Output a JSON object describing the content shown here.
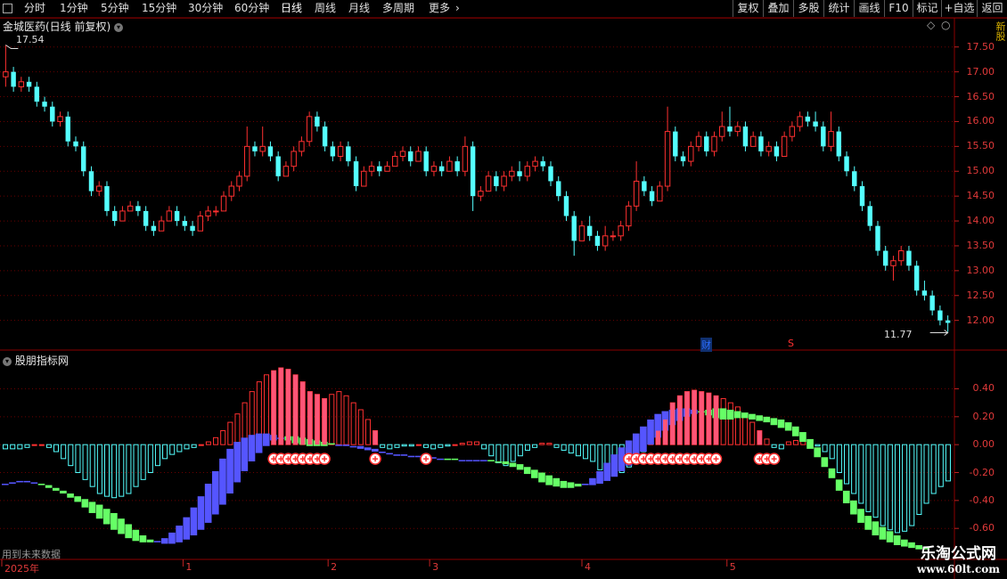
{
  "toolbar": {
    "periods": [
      "分时",
      "1分钟",
      "5分钟",
      "15分钟",
      "30分钟",
      "60分钟",
      "日线",
      "周线",
      "月线",
      "多周期",
      "更多"
    ],
    "active_period": "日线",
    "more_arrow": "›",
    "right_buttons": [
      "复权",
      "叠加",
      "多股",
      "统计",
      "画线",
      "F10",
      "标记",
      "+自选",
      "返回"
    ]
  },
  "price_panel": {
    "title": "金城医药(日线 前复权)",
    "high_label": "17.54",
    "low_label": "11.77",
    "cai_mark": "财",
    "s_mark": "S",
    "right_strip_text": "新股",
    "chart_data": {
      "type": "candlestick",
      "ylim": [
        11.6,
        17.8
      ],
      "yticks": [
        "17.50",
        "17.00",
        "16.50",
        "16.00",
        "15.50",
        "15.00",
        "14.50",
        "14.00",
        "13.50",
        "13.00",
        "12.50",
        "12.00"
      ],
      "up_color": "#ff3030",
      "down_color": "#54ffff",
      "candles": [
        [
          16.9,
          17.0,
          16.7,
          17.54
        ],
        [
          17.0,
          16.7,
          16.6,
          17.1
        ],
        [
          16.7,
          16.8,
          16.6,
          16.9
        ],
        [
          16.8,
          16.7,
          16.6,
          16.9
        ],
        [
          16.7,
          16.4,
          16.3,
          16.8
        ],
        [
          16.4,
          16.3,
          16.2,
          16.5
        ],
        [
          16.3,
          16.0,
          15.9,
          16.4
        ],
        [
          16.0,
          16.1,
          15.9,
          16.2
        ],
        [
          16.1,
          15.6,
          15.5,
          16.2
        ],
        [
          15.6,
          15.5,
          15.4,
          15.7
        ],
        [
          15.5,
          15.0,
          14.9,
          15.6
        ],
        [
          15.0,
          14.6,
          14.5,
          15.1
        ],
        [
          14.6,
          14.7,
          14.5,
          14.8
        ],
        [
          14.7,
          14.2,
          14.1,
          14.8
        ],
        [
          14.2,
          14.0,
          13.9,
          14.3
        ],
        [
          14.0,
          14.2,
          14.0,
          14.3
        ],
        [
          14.2,
          14.3,
          14.2,
          14.4
        ],
        [
          14.3,
          14.2,
          14.1,
          14.4
        ],
        [
          14.2,
          13.9,
          13.8,
          14.3
        ],
        [
          13.9,
          13.8,
          13.7,
          14.0
        ],
        [
          13.8,
          14.0,
          13.8,
          14.1
        ],
        [
          14.0,
          14.2,
          14.0,
          14.3
        ],
        [
          14.2,
          14.0,
          13.9,
          14.3
        ],
        [
          14.0,
          13.9,
          13.8,
          14.1
        ],
        [
          13.9,
          13.8,
          13.7,
          14.0
        ],
        [
          13.8,
          14.1,
          13.8,
          14.2
        ],
        [
          14.1,
          14.2,
          14.0,
          14.3
        ],
        [
          14.2,
          14.2,
          14.1,
          14.3
        ],
        [
          14.2,
          14.5,
          14.2,
          14.6
        ],
        [
          14.5,
          14.7,
          14.4,
          14.8
        ],
        [
          14.7,
          14.9,
          14.6,
          15.0
        ],
        [
          14.9,
          15.5,
          14.8,
          15.9
        ],
        [
          15.5,
          15.4,
          15.3,
          15.6
        ],
        [
          15.4,
          15.5,
          15.3,
          15.9
        ],
        [
          15.5,
          15.3,
          15.2,
          15.6
        ],
        [
          15.3,
          14.9,
          14.8,
          15.4
        ],
        [
          14.9,
          15.1,
          14.9,
          15.2
        ],
        [
          15.1,
          15.4,
          15.0,
          15.5
        ],
        [
          15.4,
          15.6,
          15.3,
          15.7
        ],
        [
          15.6,
          16.1,
          15.5,
          16.2
        ],
        [
          16.1,
          15.9,
          15.8,
          16.2
        ],
        [
          15.9,
          15.5,
          15.4,
          16.0
        ],
        [
          15.5,
          15.3,
          15.2,
          15.6
        ],
        [
          15.3,
          15.5,
          15.2,
          15.6
        ],
        [
          15.5,
          15.2,
          15.1,
          15.6
        ],
        [
          15.2,
          14.7,
          14.6,
          15.3
        ],
        [
          14.7,
          15.0,
          14.7,
          15.1
        ],
        [
          15.0,
          15.1,
          14.9,
          15.2
        ],
        [
          15.1,
          15.0,
          14.9,
          15.2
        ],
        [
          15.0,
          15.1,
          15.0,
          15.2
        ],
        [
          15.1,
          15.3,
          15.1,
          15.4
        ],
        [
          15.3,
          15.4,
          15.2,
          15.5
        ],
        [
          15.4,
          15.2,
          15.1,
          15.5
        ],
        [
          15.2,
          15.4,
          15.2,
          15.5
        ],
        [
          15.4,
          15.0,
          14.9,
          15.5
        ],
        [
          15.0,
          15.1,
          14.9,
          15.2
        ],
        [
          15.1,
          15.0,
          14.9,
          15.2
        ],
        [
          15.0,
          15.2,
          15.0,
          15.3
        ],
        [
          15.2,
          15.0,
          14.9,
          15.3
        ],
        [
          15.0,
          15.5,
          14.9,
          15.7
        ],
        [
          15.5,
          14.5,
          14.2,
          15.6
        ],
        [
          14.5,
          14.6,
          14.4,
          14.7
        ],
        [
          14.6,
          14.9,
          14.6,
          15.0
        ],
        [
          14.9,
          14.7,
          14.6,
          15.0
        ],
        [
          14.7,
          14.9,
          14.6,
          15.0
        ],
        [
          14.9,
          15.0,
          14.8,
          15.1
        ],
        [
          15.0,
          14.9,
          14.8,
          15.2
        ],
        [
          14.9,
          15.1,
          14.8,
          15.2
        ],
        [
          15.1,
          15.2,
          15.0,
          15.3
        ],
        [
          15.2,
          15.1,
          15.0,
          15.3
        ],
        [
          15.1,
          14.8,
          14.7,
          15.2
        ],
        [
          14.8,
          14.5,
          14.4,
          14.9
        ],
        [
          14.5,
          14.1,
          14.0,
          14.6
        ],
        [
          14.1,
          13.6,
          13.3,
          14.2
        ],
        [
          13.6,
          13.9,
          13.6,
          14.0
        ],
        [
          13.9,
          13.7,
          13.6,
          14.1
        ],
        [
          13.7,
          13.5,
          13.4,
          13.8
        ],
        [
          13.5,
          13.7,
          13.4,
          13.9
        ],
        [
          13.7,
          13.7,
          13.6,
          13.8
        ],
        [
          13.7,
          13.9,
          13.6,
          14.0
        ],
        [
          13.9,
          14.3,
          13.8,
          14.4
        ],
        [
          14.3,
          14.8,
          14.2,
          15.2
        ],
        [
          14.8,
          14.6,
          14.5,
          14.9
        ],
        [
          14.6,
          14.4,
          14.3,
          14.7
        ],
        [
          14.4,
          14.7,
          14.4,
          14.8
        ],
        [
          14.7,
          15.8,
          14.6,
          16.3
        ],
        [
          15.8,
          15.3,
          15.2,
          15.9
        ],
        [
          15.3,
          15.2,
          15.1,
          15.4
        ],
        [
          15.2,
          15.5,
          15.1,
          15.6
        ],
        [
          15.5,
          15.7,
          15.4,
          15.8
        ],
        [
          15.7,
          15.4,
          15.3,
          15.8
        ],
        [
          15.4,
          15.7,
          15.3,
          15.8
        ],
        [
          15.7,
          15.9,
          15.6,
          16.2
        ],
        [
          15.9,
          15.8,
          15.7,
          16.3
        ],
        [
          15.8,
          15.9,
          15.7,
          16.0
        ],
        [
          15.9,
          15.5,
          15.4,
          16.0
        ],
        [
          15.5,
          15.7,
          15.5,
          15.8
        ],
        [
          15.7,
          15.4,
          15.3,
          15.8
        ],
        [
          15.4,
          15.5,
          15.3,
          15.6
        ],
        [
          15.5,
          15.3,
          15.2,
          15.6
        ],
        [
          15.3,
          15.7,
          15.3,
          15.8
        ],
        [
          15.7,
          15.9,
          15.6,
          16.0
        ],
        [
          15.9,
          16.1,
          15.8,
          16.2
        ],
        [
          16.1,
          16.0,
          15.9,
          16.2
        ],
        [
          16.0,
          15.9,
          15.8,
          16.2
        ],
        [
          15.9,
          15.5,
          15.4,
          16.0
        ],
        [
          15.5,
          15.8,
          15.4,
          16.2
        ],
        [
          15.8,
          15.3,
          15.2,
          15.9
        ],
        [
          15.3,
          15.0,
          14.9,
          15.4
        ],
        [
          15.0,
          14.7,
          14.6,
          15.1
        ],
        [
          14.7,
          14.3,
          14.2,
          14.8
        ],
        [
          14.3,
          13.9,
          13.8,
          14.4
        ],
        [
          13.9,
          13.4,
          13.3,
          14.0
        ],
        [
          13.4,
          13.1,
          13.0,
          13.5
        ],
        [
          13.1,
          13.2,
          12.8,
          13.3
        ],
        [
          13.2,
          13.4,
          13.1,
          13.5
        ],
        [
          13.4,
          13.1,
          13.0,
          13.5
        ],
        [
          13.1,
          12.6,
          12.5,
          13.2
        ],
        [
          12.6,
          12.5,
          12.4,
          12.8
        ],
        [
          12.5,
          12.2,
          12.1,
          12.6
        ],
        [
          12.2,
          12.0,
          11.9,
          12.3
        ],
        [
          12.0,
          11.95,
          11.77,
          12.1
        ]
      ]
    }
  },
  "indicator_panel": {
    "title": "股朋指标网",
    "footer_note": "用到未来数据",
    "chart_data": {
      "type": "bar",
      "ylim": [
        -0.72,
        0.62
      ],
      "yticks": [
        "0.40",
        "0.20",
        "0.00",
        "-0.20",
        "-0.40",
        "-0.60"
      ],
      "histogram": [
        -0.03,
        -0.03,
        -0.03,
        -0.02,
        0.0,
        0.0,
        -0.02,
        -0.05,
        -0.1,
        -0.15,
        -0.2,
        -0.25,
        -0.3,
        -0.35,
        -0.37,
        -0.38,
        -0.37,
        -0.35,
        -0.3,
        -0.25,
        -0.2,
        -0.15,
        -0.1,
        -0.07,
        -0.05,
        -0.03,
        -0.02,
        0.0,
        0.02,
        0.05,
        0.1,
        0.16,
        0.22,
        0.3,
        0.38,
        0.45,
        0.5,
        0.53,
        0.55,
        0.54,
        0.5,
        0.45,
        0.38,
        0.36,
        0.33,
        0.36,
        0.38,
        0.35,
        0.3,
        0.25,
        0.18,
        0.1,
        -0.02,
        -0.03,
        -0.02,
        -0.01,
        -0.01,
        0.0,
        -0.02,
        -0.03,
        -0.02,
        -0.01,
        0.0,
        0.01,
        0.02,
        0.02,
        -0.03,
        -0.08,
        -0.13,
        -0.15,
        -0.12,
        -0.08,
        -0.04,
        -0.02,
        0.01,
        0.01,
        -0.02,
        -0.04,
        -0.06,
        -0.08,
        -0.1,
        -0.12,
        -0.18,
        -0.22,
        -0.22,
        -0.2,
        -0.16,
        -0.1,
        -0.05,
        0.05,
        0.1,
        0.18,
        0.3,
        0.35,
        0.38,
        0.39,
        0.38,
        0.37,
        0.35,
        0.33,
        0.3,
        0.27,
        0.22,
        0.16,
        0.1,
        0.04,
        -0.02,
        -0.03,
        0.02,
        0.03,
        0.04,
        0.02,
        -0.01,
        -0.05,
        -0.1,
        -0.2,
        -0.28,
        -0.35,
        -0.42,
        -0.48,
        -0.52,
        -0.58,
        -0.61,
        -0.63,
        -0.62,
        -0.58,
        -0.5,
        -0.42,
        -0.35,
        -0.3,
        -0.26
      ],
      "line_a": [
        -0.28,
        -0.27,
        -0.26,
        -0.26,
        -0.27,
        -0.29,
        -0.31,
        -0.33,
        -0.35,
        -0.38,
        -0.41,
        -0.45,
        -0.49,
        -0.53,
        -0.57,
        -0.61,
        -0.64,
        -0.67,
        -0.69,
        -0.7,
        -0.7,
        -0.69,
        -0.67,
        -0.63,
        -0.58,
        -0.52,
        -0.45,
        -0.37,
        -0.28,
        -0.19,
        -0.1,
        -0.03,
        0.02,
        0.05,
        0.07,
        0.08,
        0.08,
        0.07,
        0.05,
        0.03,
        0.01,
        0.0,
        -0.01,
        -0.01,
        -0.01,
        0.0,
        0.0,
        0.0,
        -0.01,
        -0.01,
        -0.02,
        -0.03,
        -0.05,
        -0.06,
        -0.07,
        -0.07,
        -0.08,
        -0.08,
        -0.08,
        -0.09,
        -0.1,
        -0.11,
        -0.11,
        -0.11,
        -0.11,
        -0.11,
        -0.11,
        -0.12,
        -0.13,
        -0.14,
        -0.16,
        -0.18,
        -0.21,
        -0.24,
        -0.27,
        -0.29,
        -0.3,
        -0.31,
        -0.31,
        -0.3,
        -0.28,
        -0.24,
        -0.19,
        -0.13,
        -0.07,
        -0.02,
        0.03,
        0.08,
        0.13,
        0.18,
        0.22,
        0.24,
        0.25,
        0.26,
        0.26,
        0.25,
        0.23,
        0.21,
        0.19,
        0.18,
        0.18,
        0.19,
        0.19,
        0.18,
        0.17,
        0.16,
        0.14,
        0.12,
        0.1,
        0.06,
        0.02,
        -0.03,
        -0.09,
        -0.16,
        -0.24,
        -0.33,
        -0.42,
        -0.5,
        -0.56,
        -0.61,
        -0.65,
        -0.68,
        -0.7,
        -0.72,
        -0.73,
        -0.74,
        -0.75,
        -0.75
      ],
      "line_b": [
        -0.28,
        -0.28,
        -0.27,
        -0.27,
        -0.27,
        -0.28,
        -0.29,
        -0.31,
        -0.33,
        -0.35,
        -0.37,
        -0.39,
        -0.41,
        -0.43,
        -0.46,
        -0.49,
        -0.53,
        -0.57,
        -0.61,
        -0.65,
        -0.68,
        -0.7,
        -0.71,
        -0.71,
        -0.7,
        -0.68,
        -0.65,
        -0.61,
        -0.56,
        -0.5,
        -0.43,
        -0.35,
        -0.27,
        -0.19,
        -0.12,
        -0.06,
        -0.01,
        0.03,
        0.05,
        0.06,
        0.06,
        0.05,
        0.04,
        0.03,
        0.02,
        0.01,
        0.0,
        -0.01,
        -0.02,
        -0.03,
        -0.04,
        -0.05,
        -0.06,
        -0.07,
        -0.08,
        -0.08,
        -0.09,
        -0.09,
        -0.1,
        -0.1,
        -0.1,
        -0.1,
        -0.1,
        -0.11,
        -0.11,
        -0.11,
        -0.11,
        -0.11,
        -0.12,
        -0.12,
        -0.13,
        -0.14,
        -0.16,
        -0.18,
        -0.2,
        -0.22,
        -0.24,
        -0.26,
        -0.27,
        -0.28,
        -0.29,
        -0.29,
        -0.28,
        -0.26,
        -0.23,
        -0.19,
        -0.15,
        -0.1,
        -0.05,
        0.0,
        0.05,
        0.1,
        0.14,
        0.17,
        0.2,
        0.22,
        0.24,
        0.25,
        0.26,
        0.26,
        0.25,
        0.24,
        0.23,
        0.22,
        0.21,
        0.2,
        0.19,
        0.18,
        0.16,
        0.13,
        0.09,
        0.04,
        -0.02,
        -0.09,
        -0.17,
        -0.25,
        -0.33,
        -0.4,
        -0.46,
        -0.51,
        -0.55,
        -0.59,
        -0.62,
        -0.65,
        -0.68,
        -0.7,
        -0.72,
        -0.74
      ],
      "signal_groups": [
        [
          37,
          44
        ],
        [
          51,
          51
        ],
        [
          58,
          58
        ],
        [
          86,
          98
        ],
        [
          104,
          106
        ]
      ],
      "colors": {
        "pos": "#ff3030",
        "neg": "#54ffff",
        "rise": "#66ff66",
        "fall": "#5555ff",
        "signal": "#ffffff"
      }
    }
  },
  "time_axis": {
    "labels": [
      "2025年",
      "1",
      "2",
      "3",
      "4",
      "5"
    ],
    "positions": [
      0,
      25,
      45,
      59,
      80,
      100
    ]
  },
  "watermark": {
    "line1": "乐淘公式网",
    "line2": "www.60lt.com"
  }
}
